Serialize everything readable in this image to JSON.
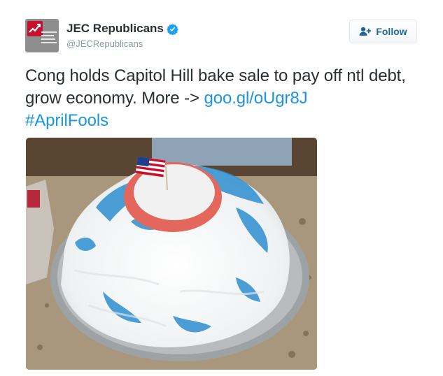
{
  "account": {
    "display_name": "JEC Republicans",
    "handle": "@JECRepublicans",
    "verified": true,
    "avatar_icon": "jec-logo-icon"
  },
  "follow_button": {
    "label": "Follow",
    "icon": "add-user-icon"
  },
  "tweet": {
    "text": "Cong holds Capitol Hill bake sale to pay off ntl debt, grow economy. More -> ",
    "link": "goo.gl/oUgr8J",
    "hashtag": "#AprilFools"
  },
  "media": {
    "subject": "cake-with-american-flag"
  },
  "colors": {
    "link": "#1b95e0",
    "verified": "#1da1f2",
    "follow_text": "#1d6796",
    "handle": "#8899a6"
  }
}
